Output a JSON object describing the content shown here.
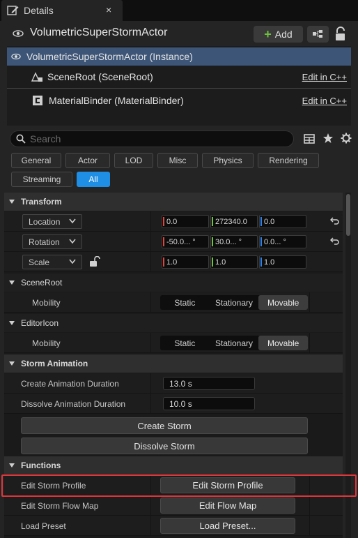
{
  "tab": {
    "label": "Details",
    "close": "×",
    "icon": "pencil-icon"
  },
  "header": {
    "actor_name": "VolumetricSuperStormActor",
    "add_label": "Add",
    "add_icon": "plus-icon",
    "blueprint_icon": "blueprint-icon",
    "lock_icon": "lock-icon"
  },
  "components": {
    "instance_label": "VolumetricSuperStormActor (Instance)",
    "items": [
      {
        "label": "SceneRoot (SceneRoot)",
        "edit": "Edit in C++"
      },
      {
        "label": "MaterialBinder (MaterialBinder)",
        "edit": "Edit in C++"
      }
    ]
  },
  "search": {
    "placeholder": "Search"
  },
  "filters": [
    "General",
    "Actor",
    "LOD",
    "Misc",
    "Physics",
    "Rendering",
    "Streaming",
    "All"
  ],
  "active_filter": "All",
  "sections": {
    "transform": {
      "title": "Transform",
      "rows": [
        {
          "label": "Location",
          "x": "0.0",
          "y": "272340.0",
          "z": "0.0"
        },
        {
          "label": "Rotation",
          "x": "-50.0... °",
          "y": "30.0... °",
          "z": "0.0... °"
        },
        {
          "label": "Scale",
          "x": "1.0",
          "y": "1.0",
          "z": "1.0"
        }
      ]
    },
    "sceneroot": {
      "title": "SceneRoot",
      "row_label": "Mobility",
      "options": [
        "Static",
        "Stationary",
        "Movable"
      ],
      "selected": "Movable"
    },
    "editoricon": {
      "title": "EditorIcon",
      "row_label": "Mobility",
      "options": [
        "Static",
        "Stationary",
        "Movable"
      ],
      "selected": "Movable"
    },
    "storm_animation": {
      "title": "Storm Animation",
      "create_label": "Create Animation Duration",
      "create_value": "13.0 s",
      "dissolve_label": "Dissolve Animation Duration",
      "dissolve_value": "10.0 s",
      "create_button": "Create Storm",
      "dissolve_button": "Dissolve Storm"
    },
    "functions": {
      "title": "Functions",
      "rows": [
        {
          "label": "Edit Storm Profile",
          "button": "Edit Storm Profile"
        },
        {
          "label": "Edit Storm Flow Map",
          "button": "Edit Flow Map"
        },
        {
          "label": "Load Preset",
          "button": "Load Preset..."
        }
      ]
    }
  },
  "colors": {
    "accent": "#1f8fe5",
    "selection": "#3d5577",
    "axis_x": "#e0443a",
    "axis_y": "#6ec33c",
    "axis_z": "#2f7fe8",
    "highlight": "#e0363c"
  }
}
